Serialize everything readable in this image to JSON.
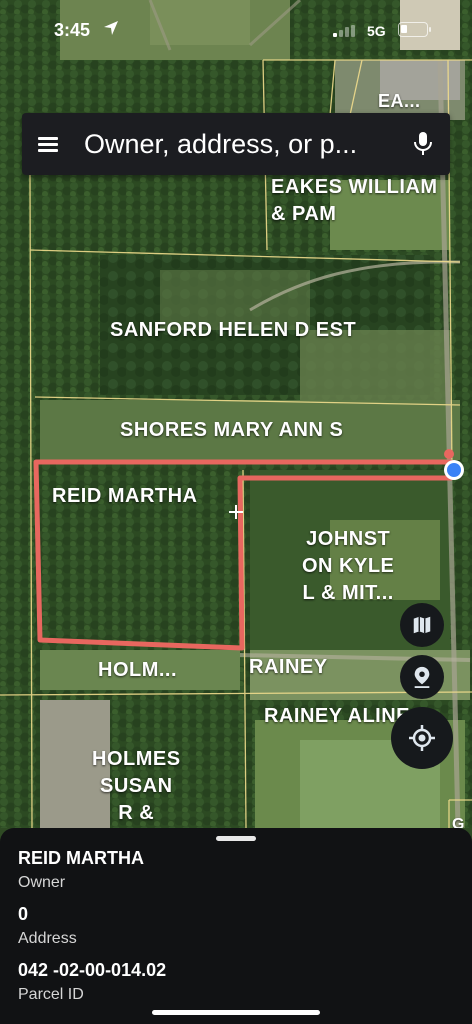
{
  "status_bar": {
    "time": "3:45",
    "network": "5G"
  },
  "search": {
    "placeholder": "Owner, address, or p..."
  },
  "map": {
    "parcel_labels": [
      "EA...",
      "EAKES WILLIAM\n& PAM",
      "SANFORD HELEN D EST",
      "SHORES MARY ANN S",
      "REID MARTHA",
      "JOHNST\nON KYLE\nL & MIT...",
      "HOLM...",
      "RAINEY",
      "RAINEY ALINE P",
      "HOLMES\nSUSAN\nR &",
      "G"
    ],
    "highlight_color": "#e8675f",
    "parcel_line_color": "#f0dc8c",
    "location_dot_color": "#3b82f6"
  },
  "controls": {
    "map_layers_icon": "map-layers-icon",
    "location_pin_icon": "location-pin-icon",
    "my_location_icon": "crosshair-gps-icon"
  },
  "details": {
    "owner_value": "REID MARTHA",
    "owner_label": "Owner",
    "address_value": "0",
    "address_label": "Address",
    "parcel_value": "042 -02-00-014.02",
    "parcel_label": "Parcel ID"
  }
}
